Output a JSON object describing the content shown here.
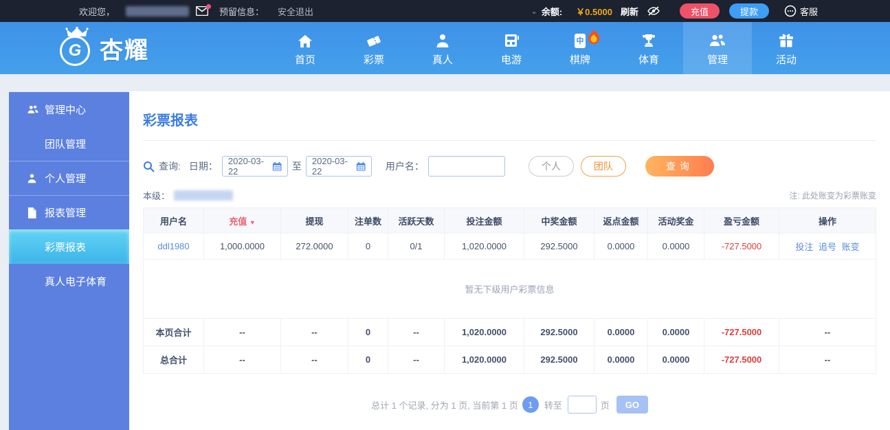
{
  "topbar": {
    "welcome": "欢迎您，",
    "reserved_info": "预留信息：",
    "logout": "安全退出",
    "balance_label": "余额:",
    "balance_value": "￥0.5000",
    "refresh": "刷新",
    "deposit": "充值",
    "withdraw": "提款",
    "service": "客服"
  },
  "nav": {
    "brand": "杏耀",
    "items": [
      {
        "label": "首页"
      },
      {
        "label": "彩票"
      },
      {
        "label": "真人"
      },
      {
        "label": "电游"
      },
      {
        "label": "棋牌",
        "hot": true
      },
      {
        "label": "体育"
      },
      {
        "label": "管理",
        "active": true
      },
      {
        "label": "活动"
      }
    ],
    "mahjong_glyph": "中"
  },
  "sidebar": {
    "items": [
      {
        "label": "管理中心"
      },
      {
        "label": "团队管理"
      },
      {
        "label": "个人管理"
      },
      {
        "label": "报表管理"
      },
      {
        "label": "彩票报表",
        "active": true
      },
      {
        "label": "真人电子体育"
      }
    ]
  },
  "main": {
    "title": "彩票报表",
    "query": {
      "label": "查询:",
      "date_label": "日期：",
      "date_from": "2020-03-22",
      "to_label": "至",
      "date_to": "2020-03-22",
      "username_label": "用户名：",
      "username_value": "",
      "btn_personal": "个人",
      "btn_team": "团队",
      "btn_query": "查询"
    },
    "level_label": "本级：",
    "note": "注: 此处账变为彩票账变",
    "table": {
      "headers": [
        "用户名",
        "充值",
        "提现",
        "注单数",
        "活跃天数",
        "投注金额",
        "中奖金额",
        "返点金额",
        "活动奖金",
        "盈亏金额",
        "操作"
      ],
      "sort_indicator": "▼",
      "row": {
        "username": "ddl1980",
        "deposit": "1,000.0000",
        "withdraw": "272.0000",
        "bet_count": "0",
        "active_days": "0/1",
        "bet_amount": "1,020.0000",
        "win_amount": "292.5000",
        "rebate": "0.0000",
        "activity_bonus": "0.0000",
        "profit_loss": "-727.5000",
        "actions": [
          "投注",
          "追号",
          "账变"
        ]
      },
      "empty_message": "暂无下级用户彩票信息",
      "page_total": {
        "label": "本页合计",
        "deposit": "--",
        "withdraw": "--",
        "bet_count": "0",
        "active_days": "--",
        "bet_amount": "1,020.0000",
        "win_amount": "292.5000",
        "rebate": "0.0000",
        "activity_bonus": "0.0000",
        "profit_loss": "-727.5000",
        "actions": "--"
      },
      "grand_total": {
        "label": "总合计",
        "deposit": "--",
        "withdraw": "--",
        "bet_count": "0",
        "active_days": "--",
        "bet_amount": "1,020.0000",
        "win_amount": "292.5000",
        "rebate": "0.0000",
        "activity_bonus": "0.0000",
        "profit_loss": "-727.5000",
        "actions": "--"
      }
    },
    "pagination": {
      "summary": "总计 1 个记录, 分为 1 页, 当前第 1 页",
      "current_page": "1",
      "goto_label": "转至",
      "page_label": "页",
      "go_label": "GO"
    }
  },
  "colors": {
    "topbar_bg": "#1c2230",
    "balance_value": "#f0a818",
    "deposit_button": "#ee5168",
    "withdraw_button": "#3e9ef5",
    "nav_bg": "#3e92e8",
    "sidebar_bg": "#5b80e0",
    "sidebar_active": "#4cc2ee",
    "title_blue": "#3a7ce0",
    "query_button_gradient": "#ffb45f-#ff7d4e",
    "sort_header_red": "#f0616e",
    "link_blue": "#5b8dd9",
    "negative_red": "#e03c3c",
    "pager_circle": "#6d9cf1"
  }
}
